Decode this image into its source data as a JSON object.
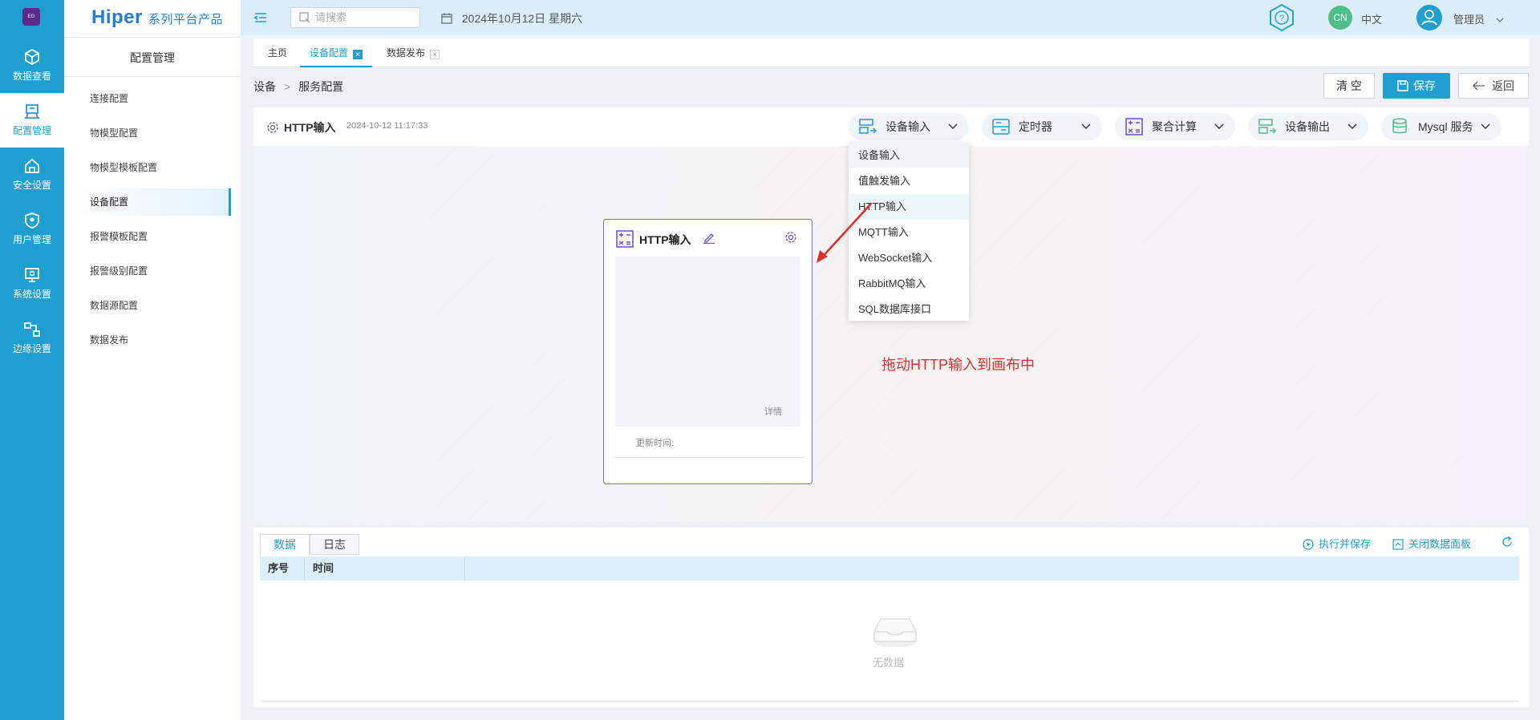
{
  "rail": {
    "logo_text": "EG",
    "items": [
      {
        "label": "数据查看"
      },
      {
        "label": "配置管理"
      },
      {
        "label": "安全设置"
      },
      {
        "label": "用户管理"
      },
      {
        "label": "系统设置"
      },
      {
        "label": "边缘设置"
      }
    ]
  },
  "menu": {
    "brand_main": "Hiper",
    "brand_sub": "系列平台产品",
    "title": "配置管理",
    "items": [
      {
        "label": "连接配置"
      },
      {
        "label": "物模型配置"
      },
      {
        "label": "物模型模板配置"
      },
      {
        "label": "设备配置"
      },
      {
        "label": "报警模板配置"
      },
      {
        "label": "报警级别配置"
      },
      {
        "label": "数据源配置"
      },
      {
        "label": "数据发布"
      }
    ]
  },
  "topbar": {
    "search_placeholder": "请搜索",
    "date": "2024年10月12日 星期六",
    "lang_badge": "CN",
    "lang_text": "中文",
    "user": "管理员"
  },
  "tabs": [
    {
      "label": "主页"
    },
    {
      "label": "设备配置"
    },
    {
      "label": "数据发布"
    }
  ],
  "breadcrumb": {
    "parent": "设备",
    "sep": ">",
    "current": "服务配置"
  },
  "actions": {
    "clear": "清 空",
    "save": "保存",
    "back": "返回"
  },
  "editor": {
    "title": "HTTP输入",
    "time": "2024-10-12 11:17:33",
    "dropdowns": [
      {
        "label": "设备输入"
      },
      {
        "label": "定时器"
      },
      {
        "label": "聚合计算"
      },
      {
        "label": "设备输出"
      },
      {
        "label": "Mysql 服务"
      }
    ]
  },
  "dropdown_menu": {
    "items": [
      "设备输入",
      "值触发输入",
      "HTTP输入",
      "MQTT输入",
      "WebSocket输入",
      "RabbitMQ输入",
      "SQL数据库接口"
    ]
  },
  "node": {
    "title": "HTTP输入",
    "detail": "详情",
    "update_label": "更新时间:"
  },
  "annotation": "拖动HTTP输入到画布中",
  "panel": {
    "tabs": [
      "数据",
      "日志"
    ],
    "run_save": "执行并保存",
    "close_panel": "关闭数据面板",
    "columns": [
      "序号",
      "时间"
    ],
    "empty": "无数据"
  },
  "colors": {
    "primary": "#1f9fd0",
    "node_border": "#7a6cc6",
    "annotation": "#e42c2c"
  }
}
